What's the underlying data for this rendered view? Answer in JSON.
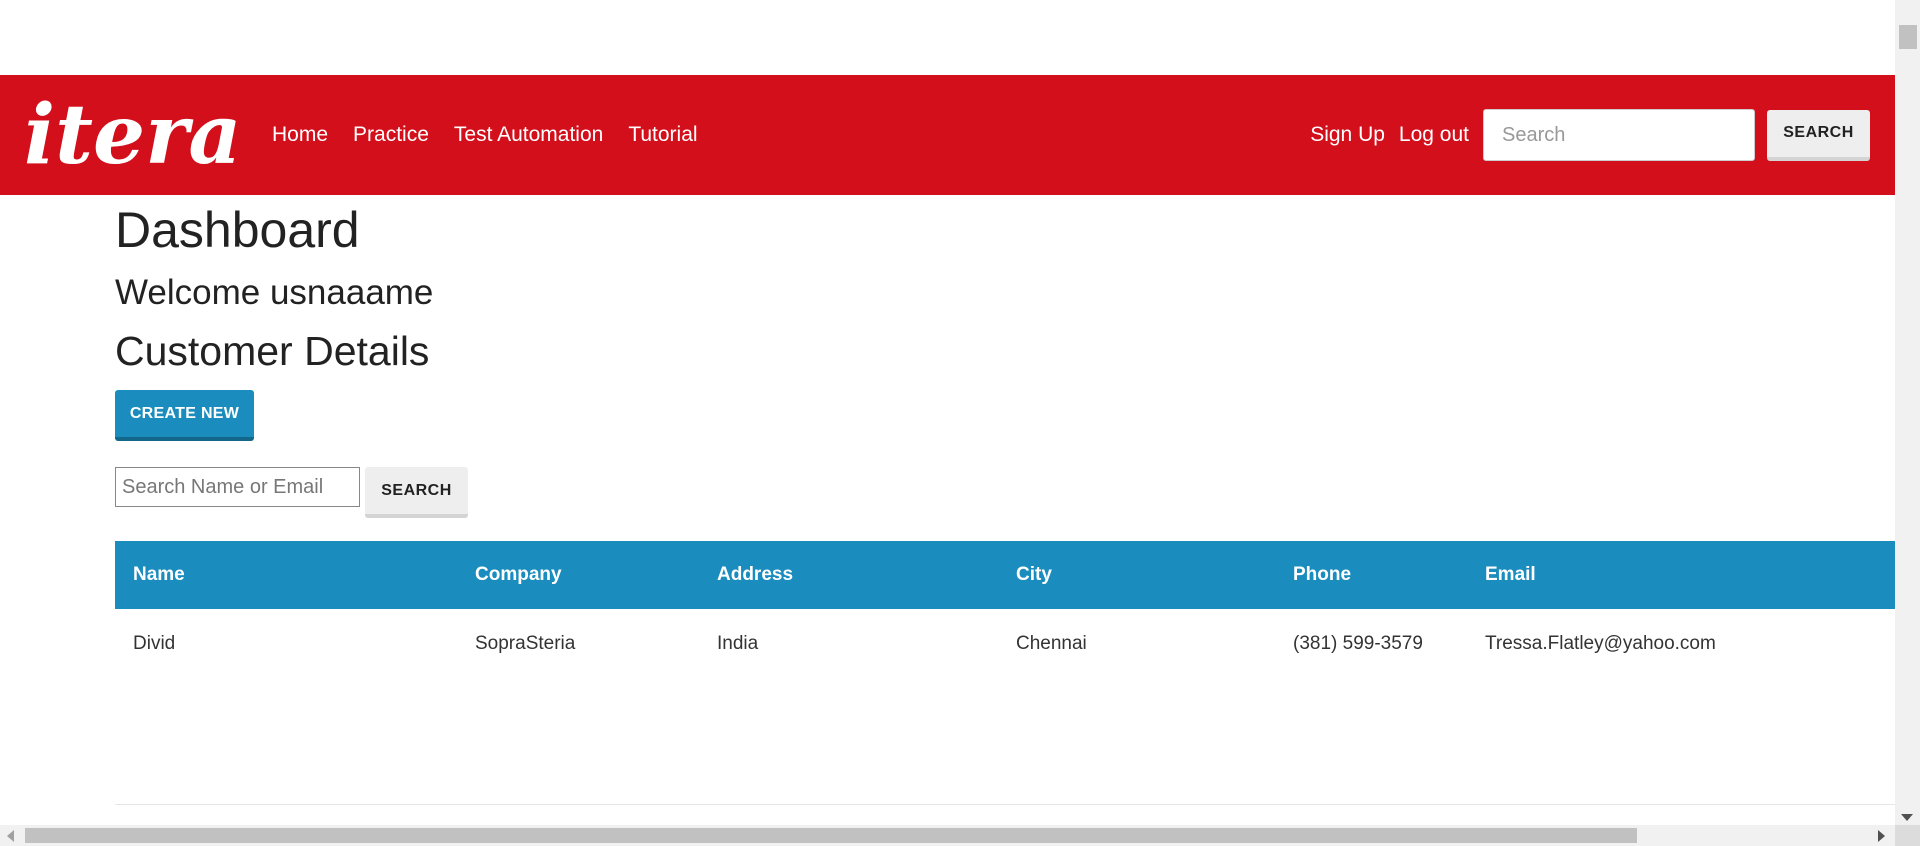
{
  "brand": {
    "logo_text": "itera",
    "color": "#d30f1b"
  },
  "nav": {
    "left_links": [
      "Home",
      "Practice",
      "Test Automation",
      "Tutorial"
    ],
    "right_links": [
      "Sign Up",
      "Log out"
    ],
    "search_placeholder": "Search",
    "search_button": "SEARCH"
  },
  "page": {
    "title": "Dashboard",
    "welcome": "Welcome usnaaame",
    "subtitle": "Customer Details",
    "create_button": "CREATE NEW",
    "search_placeholder": "Search Name or Email",
    "search_button": "SEARCH"
  },
  "table": {
    "header_color": "#1a8dbe",
    "columns": [
      "Name",
      "Company",
      "Address",
      "City",
      "Phone",
      "Email"
    ],
    "rows": [
      [
        "Divid",
        "SopraSteria",
        "India",
        "Chennai",
        "(381) 599-3579",
        "Tressa.Flatley@yahoo.com"
      ]
    ]
  }
}
